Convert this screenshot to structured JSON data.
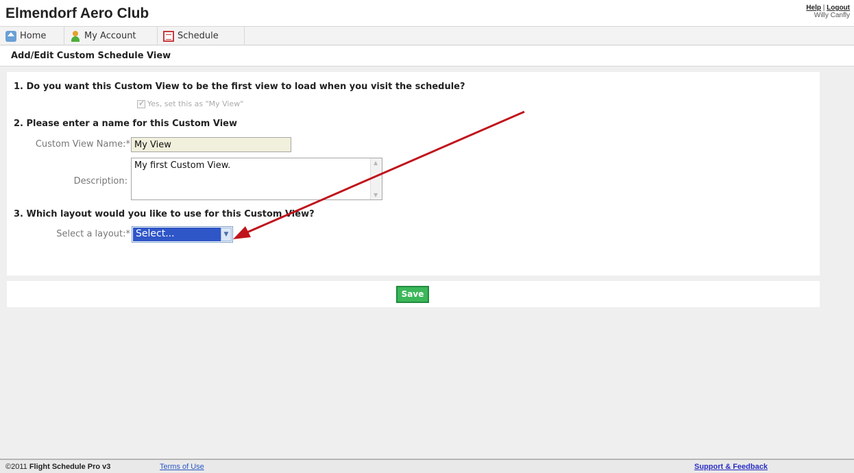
{
  "header": {
    "title": "Elmendorf Aero Club",
    "help_label": "Help",
    "separator": "|",
    "logout_label": "Logout",
    "user_name": "Willy Canfly"
  },
  "nav": {
    "tabs": [
      {
        "label": "Home",
        "icon": "home-icon"
      },
      {
        "label": "My Account",
        "icon": "user-icon"
      },
      {
        "label": "Schedule",
        "icon": "calendar-icon"
      }
    ]
  },
  "page": {
    "heading": "Add/Edit Custom Schedule View"
  },
  "form": {
    "q1": "1. Do you want this Custom View to be the first view to load when you visit the schedule?",
    "default_checkbox_label": "Yes, set this as \"My View\"",
    "default_checked": true,
    "q2": "2. Please enter a name for this Custom View",
    "name_label": "Custom View Name:*",
    "name_value": "My View",
    "description_label": "Description:",
    "description_value": "My first Custom View.",
    "q3": "3. Which layout would you like to use for this Custom View?",
    "layout_label": "Select a layout:*",
    "layout_selected": "Select..."
  },
  "actions": {
    "save_label": "Save"
  },
  "footer": {
    "copyright": "©2011",
    "product": "Flight Schedule Pro v3",
    "terms_label": "Terms of Use",
    "support_label": "Support & Feedback"
  },
  "colors": {
    "accent_select": "#2f56c7",
    "save_button": "#3bb75a",
    "annotation_arrow": "#c0141c"
  }
}
